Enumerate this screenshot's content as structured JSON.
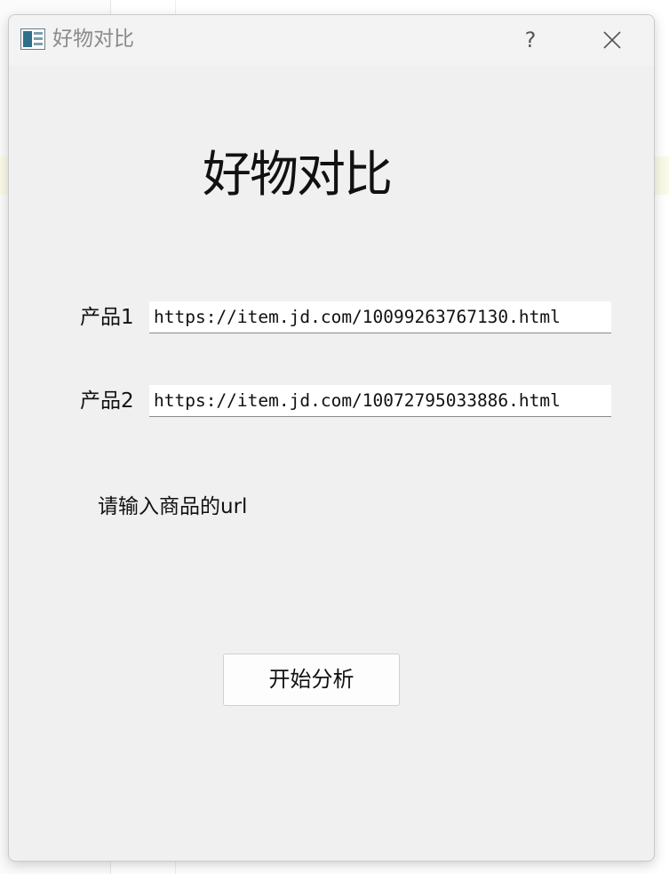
{
  "window": {
    "title": "好物对比",
    "help_label": "?",
    "icons": {
      "app": "app-window-icon",
      "close": "close-icon"
    }
  },
  "form": {
    "heading": "好物对比",
    "product1": {
      "label": "产品1",
      "value": "https://item.jd.com/10099263767130.html"
    },
    "product2": {
      "label": "产品2",
      "value": "https://item.jd.com/10072795033886.html"
    },
    "hint": "请输入商品的url",
    "start_button": "开始分析"
  }
}
